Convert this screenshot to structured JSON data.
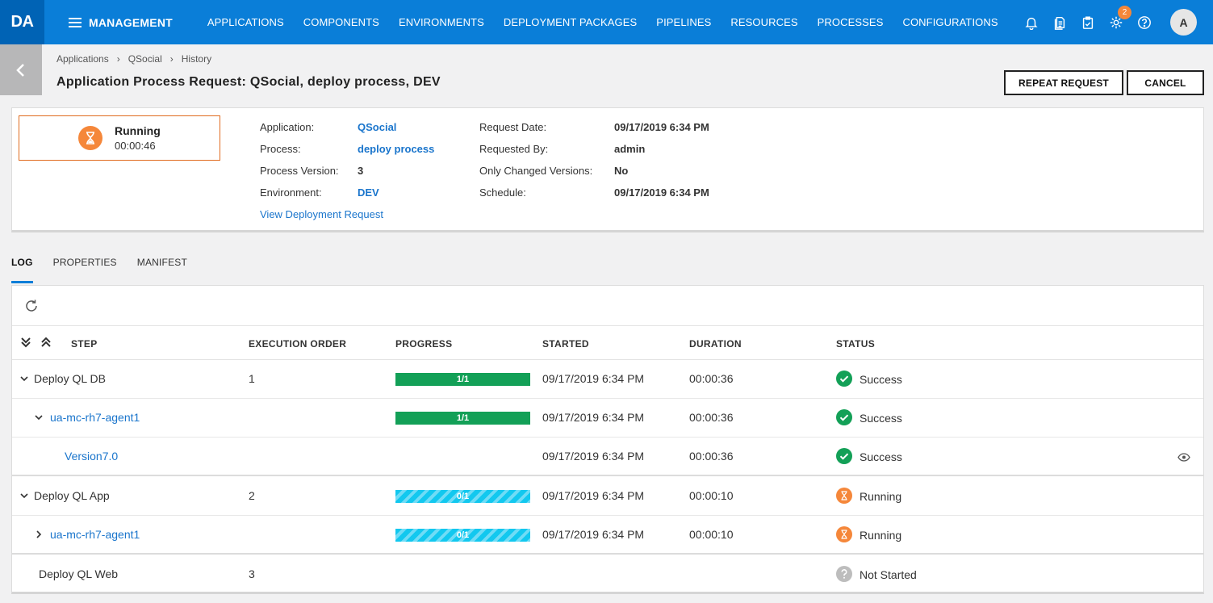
{
  "app": {
    "logo": "DA",
    "section": "MANAGEMENT"
  },
  "nav": [
    "APPLICATIONS",
    "COMPONENTS",
    "ENVIRONMENTS",
    "DEPLOYMENT PACKAGES",
    "PIPELINES",
    "RESOURCES",
    "PROCESSES",
    "CONFIGURATIONS"
  ],
  "header_icons": {
    "notifications": "bell-icon",
    "documents": "document-icon",
    "tasks": "clipboard-icon",
    "settings": "gear-icon",
    "settings_badge": "2",
    "help": "help-icon",
    "avatar": "A"
  },
  "breadcrumb": [
    "Applications",
    "QSocial",
    "History"
  ],
  "page": {
    "title": "Application Process Request: QSocial, deploy process, DEV"
  },
  "buttons": {
    "repeat": "REPEAT REQUEST",
    "cancel": "CANCEL"
  },
  "summary": {
    "status": "Running",
    "elapsed": "00:00:46",
    "application_label": "Application:",
    "application": "QSocial",
    "process_label": "Process:",
    "process": "deploy process",
    "process_version_label": "Process Version:",
    "process_version": "3",
    "environment_label": "Environment:",
    "environment": "DEV",
    "view_link": "View Deployment Request",
    "request_date_label": "Request Date:",
    "request_date": "09/17/2019 6:34 PM",
    "requested_by_label": "Requested By:",
    "requested_by": "admin",
    "only_changed_label": "Only Changed Versions:",
    "only_changed": "No",
    "schedule_label": "Schedule:",
    "schedule": "09/17/2019 6:34 PM"
  },
  "tabs": [
    "LOG",
    "PROPERTIES",
    "MANIFEST"
  ],
  "table": {
    "columns": {
      "step": "STEP",
      "order": "EXECUTION ORDER",
      "progress": "PROGRESS",
      "started": "STARTED",
      "duration": "DURATION",
      "status": "STATUS"
    },
    "rows": [
      {
        "step": "Deploy QL DB",
        "order": "1",
        "progress": "1/1",
        "progress_fraction": 1,
        "started": "09/17/2019 6:34 PM",
        "duration": "00:00:36",
        "status": "Success"
      },
      {
        "step": "ua-mc-rh7-agent1",
        "order": "",
        "progress": "1/1",
        "progress_fraction": 1,
        "started": "09/17/2019 6:34 PM",
        "duration": "00:00:36",
        "status": "Success"
      },
      {
        "step": "Version7.0",
        "order": "",
        "progress": "",
        "started": "09/17/2019 6:34 PM",
        "duration": "00:00:36",
        "status": "Success"
      },
      {
        "step": "Deploy QL App",
        "order": "2",
        "progress": "0/1",
        "progress_fraction": 0,
        "started": "09/17/2019 6:34 PM",
        "duration": "00:00:10",
        "status": "Running"
      },
      {
        "step": "ua-mc-rh7-agent1",
        "order": "",
        "progress": "0/1",
        "progress_fraction": 0,
        "started": "09/17/2019 6:34 PM",
        "duration": "00:00:10",
        "status": "Running"
      },
      {
        "step": "Deploy QL Web",
        "order": "3",
        "progress": "",
        "started": "",
        "duration": "",
        "status": "Not Started"
      }
    ]
  },
  "colors": {
    "topbar": "#0a7ed8",
    "success": "#13a057",
    "running": "#f5873a",
    "link": "#1a75cc"
  }
}
